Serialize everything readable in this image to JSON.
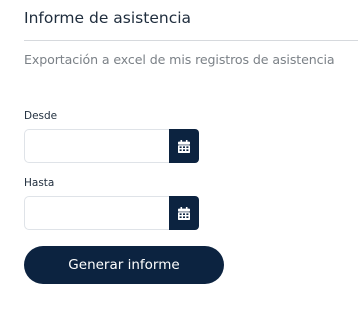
{
  "header": {
    "title": "Informe de asistencia",
    "subtitle": "Exportación a excel de mis registros de asistencia"
  },
  "form": {
    "from": {
      "label": "Desde",
      "value": "",
      "placeholder": "",
      "icon": "calendar-icon"
    },
    "to": {
      "label": "Hasta",
      "value": "",
      "placeholder": "",
      "icon": "calendar-icon"
    },
    "submit_label": "Generar informe"
  },
  "colors": {
    "accent": "#0c2340",
    "divider": "#d6d9dd",
    "muted_text": "#7b8187"
  }
}
